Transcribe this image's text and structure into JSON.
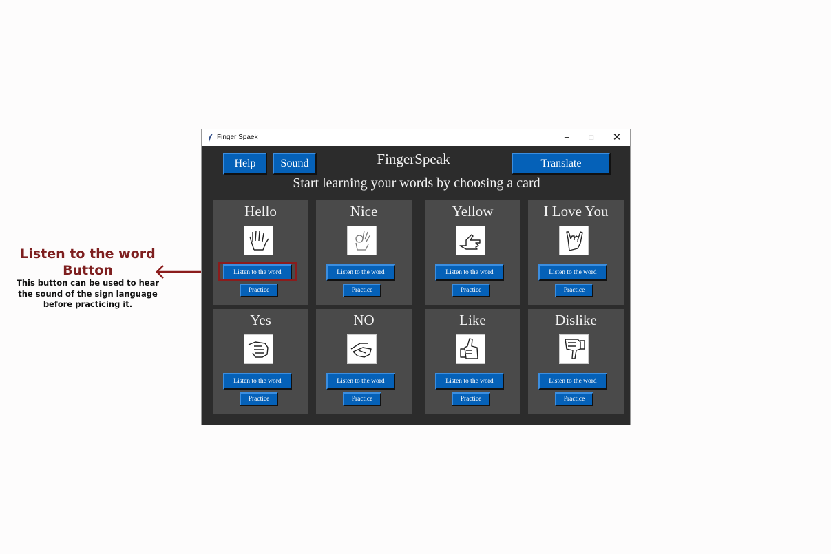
{
  "annotation": {
    "title_line1": "Listen to the word",
    "title_line2": "Button",
    "description_line1": "This button can be used to hear",
    "description_line2": "the sound of the sign language",
    "description_line3": "before practicing it."
  },
  "window": {
    "title": "Finger Spaek",
    "minimize": "−",
    "maximize": "□",
    "close": "✕"
  },
  "header": {
    "help_label": "Help",
    "sound_label": "Sound",
    "app_title": "FingerSpeak",
    "translate_label": "Translate",
    "subtitle": "Start learning your words by choosing a card"
  },
  "cards": [
    {
      "word": "Hello",
      "icon": "open-hand-icon",
      "listen_label": "Listen to the word",
      "practice_label": "Practice"
    },
    {
      "word": "Nice",
      "icon": "ok-hand-icon",
      "listen_label": "Listen to the word",
      "practice_label": "Practice"
    },
    {
      "word": "Yellow",
      "icon": "y-hand-icon",
      "listen_label": "Listen to the word",
      "practice_label": "Practice"
    },
    {
      "word": "I Love You",
      "icon": "ily-hand-icon",
      "listen_label": "Listen to the word",
      "practice_label": "Practice"
    },
    {
      "word": "Yes",
      "icon": "fist-hand-icon",
      "listen_label": "Listen to the word",
      "practice_label": "Practice"
    },
    {
      "word": "NO",
      "icon": "no-hand-icon",
      "listen_label": "Listen to the word",
      "practice_label": "Practice"
    },
    {
      "word": "Like",
      "icon": "thumbs-up-icon",
      "listen_label": "Listen to the word",
      "practice_label": "Practice"
    },
    {
      "word": "Dislike",
      "icon": "thumbs-down-icon",
      "listen_label": "Listen to the word",
      "practice_label": "Practice"
    }
  ],
  "colors": {
    "window_bg": "#2c2c2c",
    "card_bg": "#4a4a4a",
    "button": "#0561b8",
    "annotation": "#7e1f1f"
  }
}
